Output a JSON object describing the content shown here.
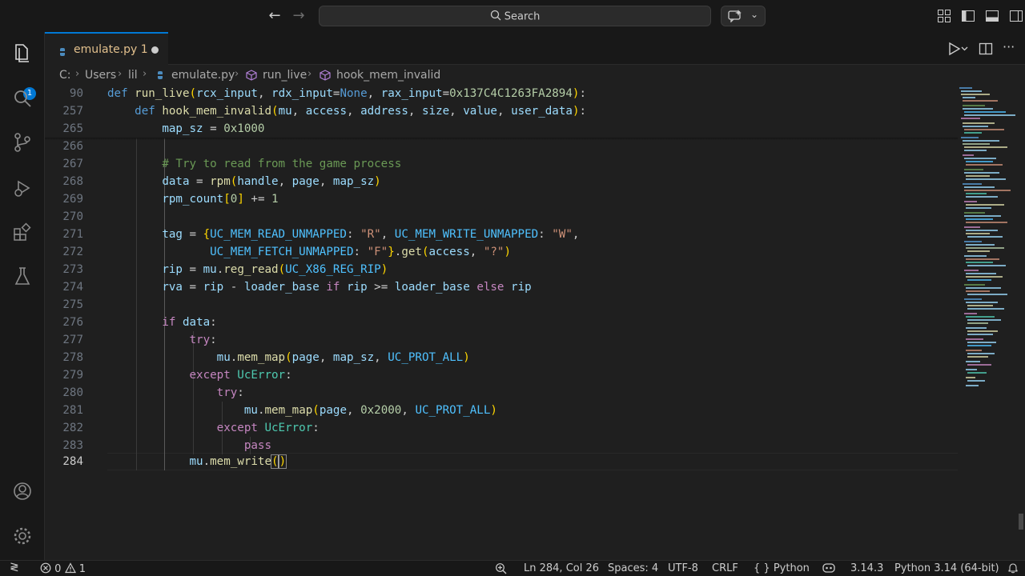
{
  "titlebar": {
    "search_placeholder": "Search"
  },
  "activity_bar": {
    "explorer_badge": "1"
  },
  "tabs": [
    {
      "label": "emulate.py",
      "problems": "1",
      "dirty": true
    }
  ],
  "breadcrumbs": {
    "drive": "C:",
    "users": "Users",
    "user": "lil",
    "file": "emulate.py",
    "func1": "run_live",
    "func2": "hook_mem_invalid"
  },
  "editor": {
    "line_numbers": [
      "90",
      "257",
      "265",
      "266",
      "267",
      "268",
      "269",
      "270",
      "271",
      "272",
      "273",
      "274",
      "275",
      "276",
      "277",
      "278",
      "279",
      "280",
      "281",
      "282",
      "283",
      "284"
    ],
    "current_line": "284"
  },
  "status": {
    "errors": "0",
    "warnings": "1",
    "position": "Ln 284, Col 26",
    "spaces": "Spaces: 4",
    "encoding": "UTF-8",
    "eol": "CRLF",
    "language": "Python",
    "python_version": "3.14.3",
    "interpreter": "Python 3.14 (64-bit)"
  },
  "colors": {
    "accent": "#0078d4",
    "background": "#1f1f1f",
    "chrome": "#181818",
    "modified_tab": "#e2c08d"
  }
}
